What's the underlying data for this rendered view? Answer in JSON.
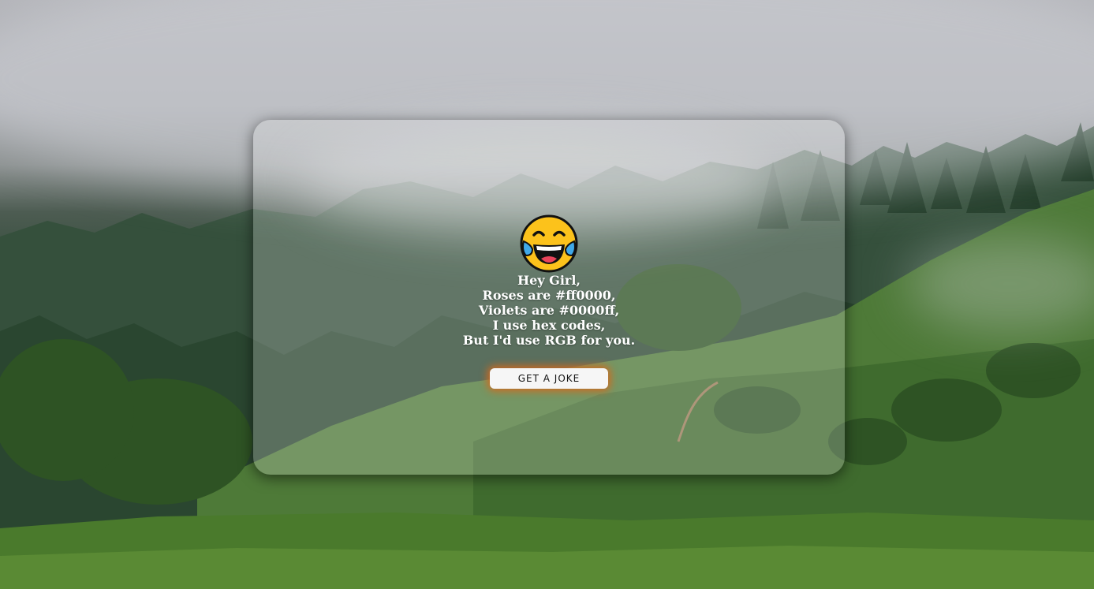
{
  "background": {
    "sky_color": "#b2b3b8",
    "forest_color": "#2f4a36",
    "meadow_color": "#4f7d2f"
  },
  "card": {
    "emoji_icon": "face-with-tears-of-joy-icon",
    "joke_lines": [
      "Hey Girl,",
      "Roses are #ff0000,",
      "Violets are #0000ff,",
      "I use hex codes,",
      "But I'd use RGB for you."
    ],
    "button_label": "GET A JOKE",
    "button_glow_color": "#d6681a"
  }
}
